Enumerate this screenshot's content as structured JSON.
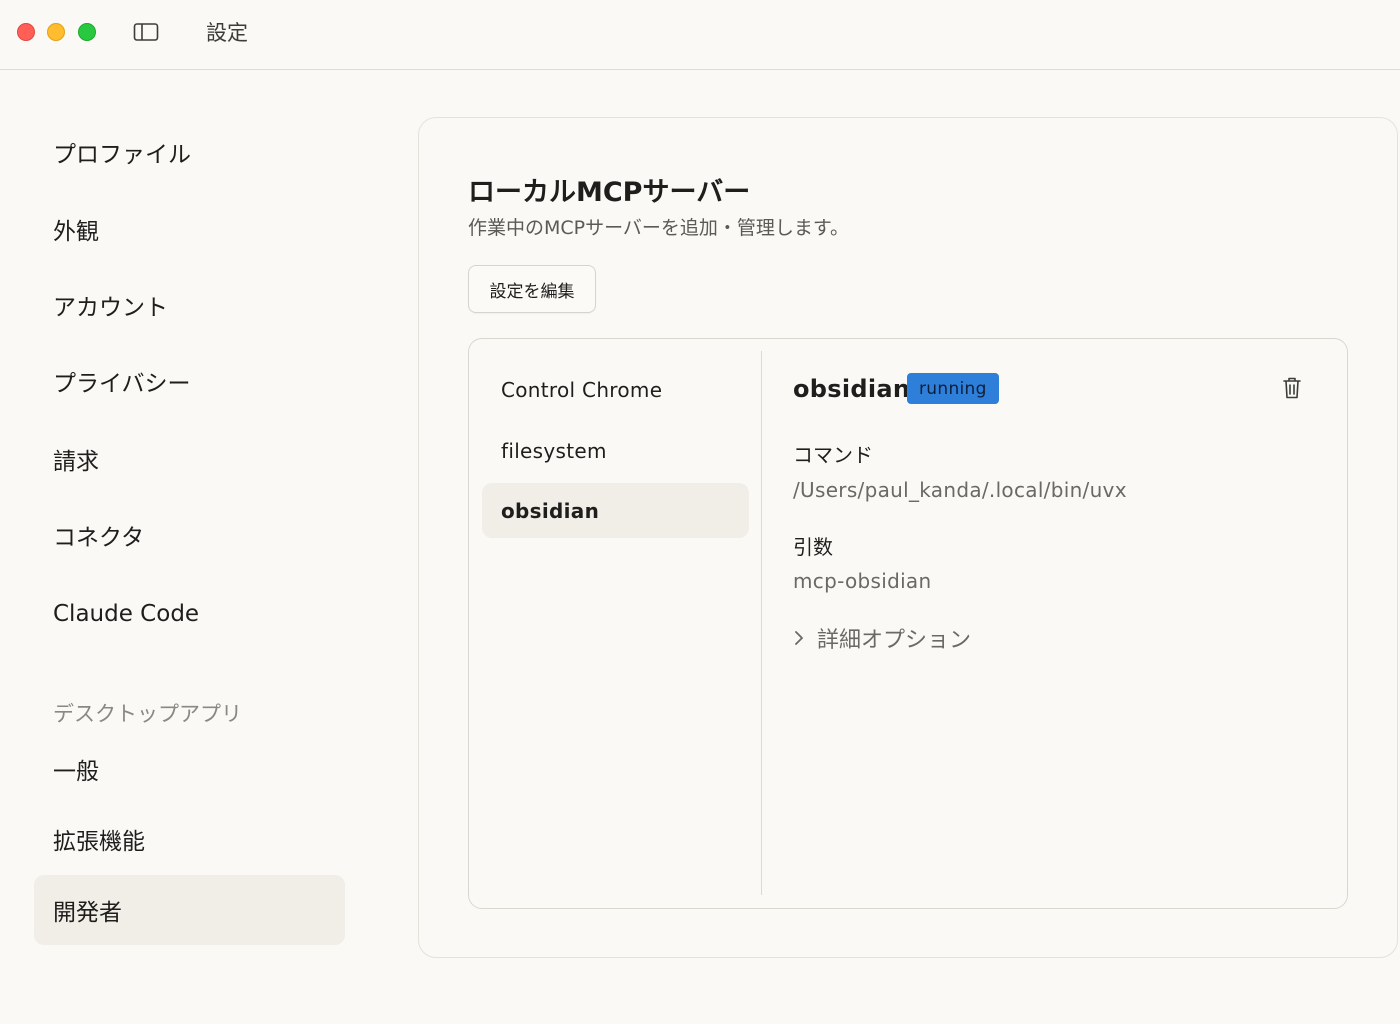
{
  "window": {
    "title": "設定"
  },
  "sidebar": {
    "items": [
      {
        "label": "プロファイル"
      },
      {
        "label": "外観"
      },
      {
        "label": "アカウント"
      },
      {
        "label": "プライバシー"
      },
      {
        "label": "請求"
      },
      {
        "label": "コネクタ"
      },
      {
        "label": "Claude Code"
      }
    ],
    "section_label": "デスクトップアプリ",
    "section_items": [
      {
        "label": "一般"
      },
      {
        "label": "拡張機能"
      },
      {
        "label": "開発者",
        "active": true
      }
    ]
  },
  "main": {
    "title_prefix": "ローカル",
    "title_bold": "MCP",
    "title_suffix": "サーバー",
    "subtitle": "作業中のMCPサーバーを追加・管理します。",
    "edit_button": "設定を編集",
    "servers": [
      {
        "name": "Control Chrome"
      },
      {
        "name": "filesystem"
      },
      {
        "name": "obsidian",
        "active": true
      }
    ],
    "detail": {
      "name": "obsidian",
      "status": "running",
      "command_label": "コマンド",
      "command_value": "/Users/paul_kanda/.local/bin/uvx",
      "args_label": "引数",
      "args_value": "mcp-obsidian",
      "advanced_label": "詳細オプション"
    }
  },
  "colors": {
    "background": "#faf9f5",
    "active_item": "#f0eee6",
    "status_badge": "#2e7fd9"
  },
  "icons": [
    "sidebar-toggle-icon",
    "trash-icon",
    "chevron-right-icon"
  ]
}
